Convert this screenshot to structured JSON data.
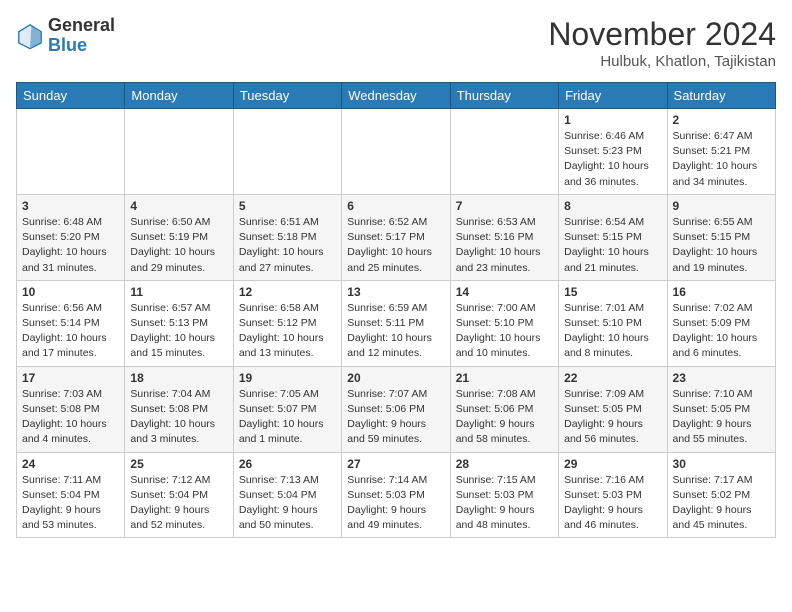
{
  "header": {
    "logo_general": "General",
    "logo_blue": "Blue",
    "title": "November 2024",
    "location": "Hulbuk, Khatlon, Tajikistan"
  },
  "days_of_week": [
    "Sunday",
    "Monday",
    "Tuesday",
    "Wednesday",
    "Thursday",
    "Friday",
    "Saturday"
  ],
  "weeks": [
    [
      {
        "day": "",
        "info": ""
      },
      {
        "day": "",
        "info": ""
      },
      {
        "day": "",
        "info": ""
      },
      {
        "day": "",
        "info": ""
      },
      {
        "day": "",
        "info": ""
      },
      {
        "day": "1",
        "info": "Sunrise: 6:46 AM\nSunset: 5:23 PM\nDaylight: 10 hours\nand 36 minutes."
      },
      {
        "day": "2",
        "info": "Sunrise: 6:47 AM\nSunset: 5:21 PM\nDaylight: 10 hours\nand 34 minutes."
      }
    ],
    [
      {
        "day": "3",
        "info": "Sunrise: 6:48 AM\nSunset: 5:20 PM\nDaylight: 10 hours\nand 31 minutes."
      },
      {
        "day": "4",
        "info": "Sunrise: 6:50 AM\nSunset: 5:19 PM\nDaylight: 10 hours\nand 29 minutes."
      },
      {
        "day": "5",
        "info": "Sunrise: 6:51 AM\nSunset: 5:18 PM\nDaylight: 10 hours\nand 27 minutes."
      },
      {
        "day": "6",
        "info": "Sunrise: 6:52 AM\nSunset: 5:17 PM\nDaylight: 10 hours\nand 25 minutes."
      },
      {
        "day": "7",
        "info": "Sunrise: 6:53 AM\nSunset: 5:16 PM\nDaylight: 10 hours\nand 23 minutes."
      },
      {
        "day": "8",
        "info": "Sunrise: 6:54 AM\nSunset: 5:15 PM\nDaylight: 10 hours\nand 21 minutes."
      },
      {
        "day": "9",
        "info": "Sunrise: 6:55 AM\nSunset: 5:15 PM\nDaylight: 10 hours\nand 19 minutes."
      }
    ],
    [
      {
        "day": "10",
        "info": "Sunrise: 6:56 AM\nSunset: 5:14 PM\nDaylight: 10 hours\nand 17 minutes."
      },
      {
        "day": "11",
        "info": "Sunrise: 6:57 AM\nSunset: 5:13 PM\nDaylight: 10 hours\nand 15 minutes."
      },
      {
        "day": "12",
        "info": "Sunrise: 6:58 AM\nSunset: 5:12 PM\nDaylight: 10 hours\nand 13 minutes."
      },
      {
        "day": "13",
        "info": "Sunrise: 6:59 AM\nSunset: 5:11 PM\nDaylight: 10 hours\nand 12 minutes."
      },
      {
        "day": "14",
        "info": "Sunrise: 7:00 AM\nSunset: 5:10 PM\nDaylight: 10 hours\nand 10 minutes."
      },
      {
        "day": "15",
        "info": "Sunrise: 7:01 AM\nSunset: 5:10 PM\nDaylight: 10 hours\nand 8 minutes."
      },
      {
        "day": "16",
        "info": "Sunrise: 7:02 AM\nSunset: 5:09 PM\nDaylight: 10 hours\nand 6 minutes."
      }
    ],
    [
      {
        "day": "17",
        "info": "Sunrise: 7:03 AM\nSunset: 5:08 PM\nDaylight: 10 hours\nand 4 minutes."
      },
      {
        "day": "18",
        "info": "Sunrise: 7:04 AM\nSunset: 5:08 PM\nDaylight: 10 hours\nand 3 minutes."
      },
      {
        "day": "19",
        "info": "Sunrise: 7:05 AM\nSunset: 5:07 PM\nDaylight: 10 hours\nand 1 minute."
      },
      {
        "day": "20",
        "info": "Sunrise: 7:07 AM\nSunset: 5:06 PM\nDaylight: 9 hours\nand 59 minutes."
      },
      {
        "day": "21",
        "info": "Sunrise: 7:08 AM\nSunset: 5:06 PM\nDaylight: 9 hours\nand 58 minutes."
      },
      {
        "day": "22",
        "info": "Sunrise: 7:09 AM\nSunset: 5:05 PM\nDaylight: 9 hours\nand 56 minutes."
      },
      {
        "day": "23",
        "info": "Sunrise: 7:10 AM\nSunset: 5:05 PM\nDaylight: 9 hours\nand 55 minutes."
      }
    ],
    [
      {
        "day": "24",
        "info": "Sunrise: 7:11 AM\nSunset: 5:04 PM\nDaylight: 9 hours\nand 53 minutes."
      },
      {
        "day": "25",
        "info": "Sunrise: 7:12 AM\nSunset: 5:04 PM\nDaylight: 9 hours\nand 52 minutes."
      },
      {
        "day": "26",
        "info": "Sunrise: 7:13 AM\nSunset: 5:04 PM\nDaylight: 9 hours\nand 50 minutes."
      },
      {
        "day": "27",
        "info": "Sunrise: 7:14 AM\nSunset: 5:03 PM\nDaylight: 9 hours\nand 49 minutes."
      },
      {
        "day": "28",
        "info": "Sunrise: 7:15 AM\nSunset: 5:03 PM\nDaylight: 9 hours\nand 48 minutes."
      },
      {
        "day": "29",
        "info": "Sunrise: 7:16 AM\nSunset: 5:03 PM\nDaylight: 9 hours\nand 46 minutes."
      },
      {
        "day": "30",
        "info": "Sunrise: 7:17 AM\nSunset: 5:02 PM\nDaylight: 9 hours\nand 45 minutes."
      }
    ]
  ]
}
